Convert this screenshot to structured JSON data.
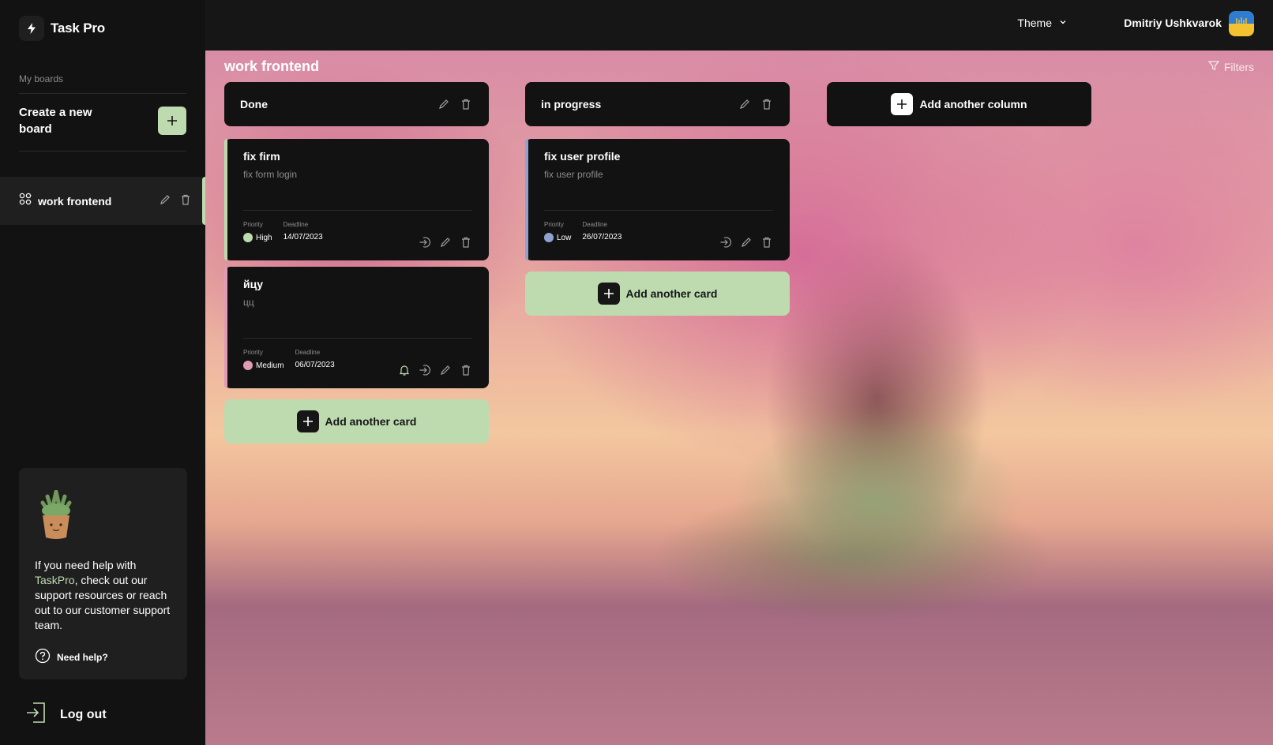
{
  "app": {
    "name": "Task Pro"
  },
  "sidebar": {
    "my_boards_label": "My boards",
    "create_board_label": "Create a new board",
    "boards": [
      {
        "name": "work frontend",
        "active": true
      }
    ],
    "help": {
      "text_before": "If you need help with ",
      "brand": "TaskPro",
      "text_after": ", check out our support resources or reach out to our customer support team.",
      "link_label": "Need help?"
    },
    "logout_label": "Log out"
  },
  "header": {
    "theme_label": "Theme",
    "user_name": "Dmitriy Ushkvarok"
  },
  "board": {
    "title": "work frontend",
    "filters_label": "Filters",
    "add_column_label": "Add another column",
    "columns": [
      {
        "title": "Done",
        "cards": [
          {
            "title": "fix firm",
            "description": "fix form login",
            "priority_label": "Priority",
            "priority": "High",
            "deadline_label": "Deadline",
            "deadline": "14/07/2023",
            "color": "#bedbb0"
          },
          {
            "title": "йцу",
            "description": "цц",
            "priority_label": "Priority",
            "priority": "Medium",
            "deadline_label": "Deadline",
            "deadline": "06/07/2023",
            "color": "#e09cb5"
          }
        ],
        "add_card_label": "Add another card"
      },
      {
        "title": "in progress",
        "cards": [
          {
            "title": "fix user profile",
            "description": "fix user profile",
            "priority_label": "Priority",
            "priority": "Low",
            "deadline_label": "Deadline",
            "deadline": "26/07/2023",
            "color": "#8fa1d0"
          }
        ],
        "add_card_label": "Add another card"
      }
    ]
  },
  "colors": {
    "accent": "#bedbb0",
    "panel": "#121212",
    "sidebar_active": "#1f1f1f"
  }
}
